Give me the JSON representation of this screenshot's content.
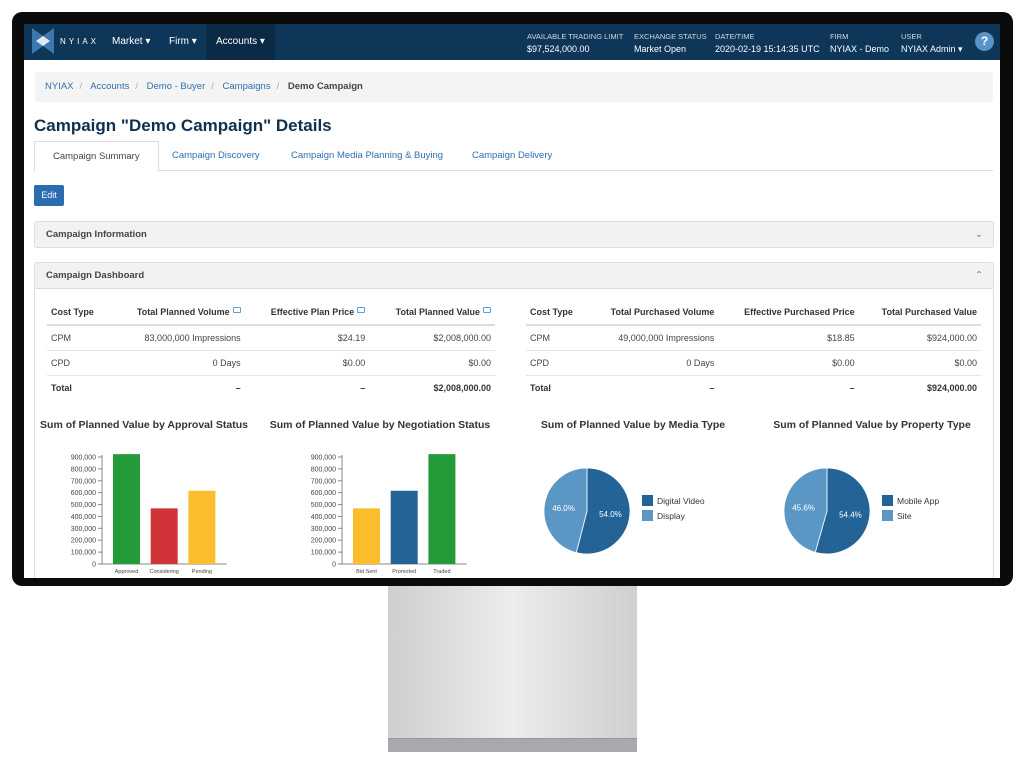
{
  "nav": {
    "logo": "NYIAX",
    "menus": [
      "Market",
      "Firm",
      "Accounts"
    ],
    "stats": [
      {
        "k": "AVAILABLE TRADING LIMIT",
        "v": "$97,524,000.00"
      },
      {
        "k": "EXCHANGE STATUS",
        "v": "Market Open"
      },
      {
        "k": "DATE/TIME",
        "v": "2020-02-19 15:14:35 UTC"
      },
      {
        "k": "FIRM",
        "v": "NYIAX - Demo"
      },
      {
        "k": "USER",
        "v": "NYIAX Admin"
      }
    ],
    "help": "?"
  },
  "breadcrumb": [
    "NYIAX",
    "Accounts",
    "Demo - Buyer",
    "Campaigns",
    "Demo Campaign"
  ],
  "title": "Campaign \"Demo Campaign\" Details",
  "tabs": [
    "Campaign Summary",
    "Campaign Discovery",
    "Campaign Media Planning & Buying",
    "Campaign Delivery"
  ],
  "edit_label": "Edit",
  "panels": {
    "info": "Campaign Information",
    "dashboard": "Campaign Dashboard"
  },
  "planned_table": {
    "headers": [
      "Cost Type",
      "Total Planned Volume",
      "Effective Plan Price",
      "Total Planned Value"
    ],
    "rows": [
      [
        "CPM",
        "83,000,000 Impressions",
        "$24.19",
        "$2,008,000.00"
      ],
      [
        "CPD",
        "0 Days",
        "$0.00",
        "$0.00"
      ],
      [
        "Total",
        "–",
        "–",
        "$2,008,000.00"
      ]
    ]
  },
  "purchased_table": {
    "headers": [
      "Cost Type",
      "Total Purchased Volume",
      "Effective Purchased Price",
      "Total Purchased Value"
    ],
    "rows": [
      [
        "CPM",
        "49,000,000 Impressions",
        "$18.85",
        "$924,000.00"
      ],
      [
        "CPD",
        "0 Days",
        "$0.00",
        "$0.00"
      ],
      [
        "Total",
        "–",
        "–",
        "$924,000.00"
      ]
    ]
  },
  "chart_data": [
    {
      "type": "bar",
      "title": "Sum of Planned Value by Approval Status",
      "categories": [
        "Approved",
        "Considering",
        "Pending"
      ],
      "values": [
        924000,
        468000,
        616000
      ],
      "colors": [
        "#239b38",
        "#d13438",
        "#fbbd2c"
      ],
      "ylim": [
        0,
        900000
      ],
      "yticks": [
        "0",
        "100,000",
        "200,000",
        "300,000",
        "400,000",
        "500,000",
        "600,000",
        "700,000",
        "800,000",
        "900,000"
      ]
    },
    {
      "type": "bar",
      "title": "Sum of Planned Value by Negotiation Status",
      "categories": [
        "Bid Sent",
        "Promoted",
        "Traded"
      ],
      "values": [
        468000,
        616000,
        924000
      ],
      "colors": [
        "#fbbd2c",
        "#236396",
        "#239b38"
      ],
      "ylim": [
        0,
        900000
      ],
      "yticks": [
        "0",
        "100,000",
        "200,000",
        "300,000",
        "400,000",
        "500,000",
        "600,000",
        "700,000",
        "800,000",
        "900,000"
      ]
    },
    {
      "type": "pie",
      "title": "Sum of Planned Value by Media Type",
      "labels": [
        "Digital Video",
        "Display"
      ],
      "values": [
        54.0,
        46.0
      ],
      "value_labels": [
        "54.0%",
        "46.0%"
      ],
      "colors": [
        "#236396",
        "#5b97c4"
      ],
      "legend": "right"
    },
    {
      "type": "pie",
      "title": "Sum of Planned Value by Property Type",
      "labels": [
        "Mobile App",
        "Site"
      ],
      "values": [
        54.4,
        45.6
      ],
      "value_labels": [
        "54.4%",
        "45.6%"
      ],
      "colors": [
        "#236396",
        "#5b97c4"
      ],
      "legend": "right"
    }
  ]
}
